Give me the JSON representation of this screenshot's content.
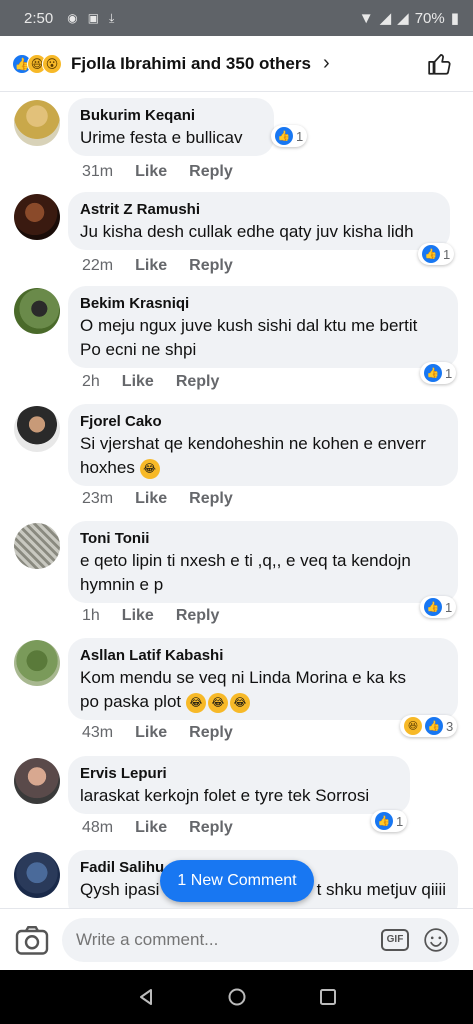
{
  "status_bar": {
    "time": "2:50",
    "battery": "70%"
  },
  "reactions_header": {
    "label": "Fjolla Ibrahimi and 350 others"
  },
  "comments": [
    {
      "author": "Bukurim Keqani",
      "lines": [
        "Urime festa e bullicav"
      ],
      "time": "31m",
      "like": "Like",
      "reply": "Reply",
      "reaction_count": "1"
    },
    {
      "author": "Astrit Z Ramushi",
      "lines": [
        "Ju kisha desh cullak edhe qaty juv kisha lidh"
      ],
      "time": "22m",
      "like": "Like",
      "reply": "Reply",
      "reaction_count": "1"
    },
    {
      "author": "Bekim Krasniqi",
      "lines": [
        "O meju ngux juve kush sishi dal ktu me bertit",
        "Po ecni ne shpi"
      ],
      "time": "2h",
      "like": "Like",
      "reply": "Reply",
      "reaction_count": "1"
    },
    {
      "author": "Fjorel Cako",
      "lines": [
        "Si vjershat qe kendoheshin ne kohen e enverr",
        "hoxhes"
      ],
      "time": "23m",
      "like": "Like",
      "reply": "Reply"
    },
    {
      "author": "Toni Tonii",
      "lines": [
        "e qeto lipin ti nxesh e ti ,q,, e veq ta kendojn",
        "hymnin e p"
      ],
      "time": "1h",
      "like": "Like",
      "reply": "Reply",
      "reaction_count": "1"
    },
    {
      "author": "Asllan Latif Kabashi",
      "lines": [
        "Kom mendu se veq ni Linda Morina e ka ks",
        "po paska plot"
      ],
      "time": "43m",
      "like": "Like",
      "reply": "Reply",
      "reaction_count": "3"
    },
    {
      "author": "Ervis Lepuri",
      "lines": [
        "laraskat kerkojn folet e tyre tek Sorrosi"
      ],
      "time": "48m",
      "like": "Like",
      "reply": "Reply",
      "reaction_count": "1"
    },
    {
      "author": "Fadil Salihu",
      "lines": [
        "Qysh ipasi",
        "t shku metjuv qiiii"
      ]
    }
  ],
  "new_comment_pill": "1 New Comment",
  "composer": {
    "placeholder": "Write a comment...",
    "gif_label": "GIF"
  },
  "colors": {
    "accent": "#1877f2",
    "bubble": "#f0f2f5",
    "meta": "#65676b"
  }
}
